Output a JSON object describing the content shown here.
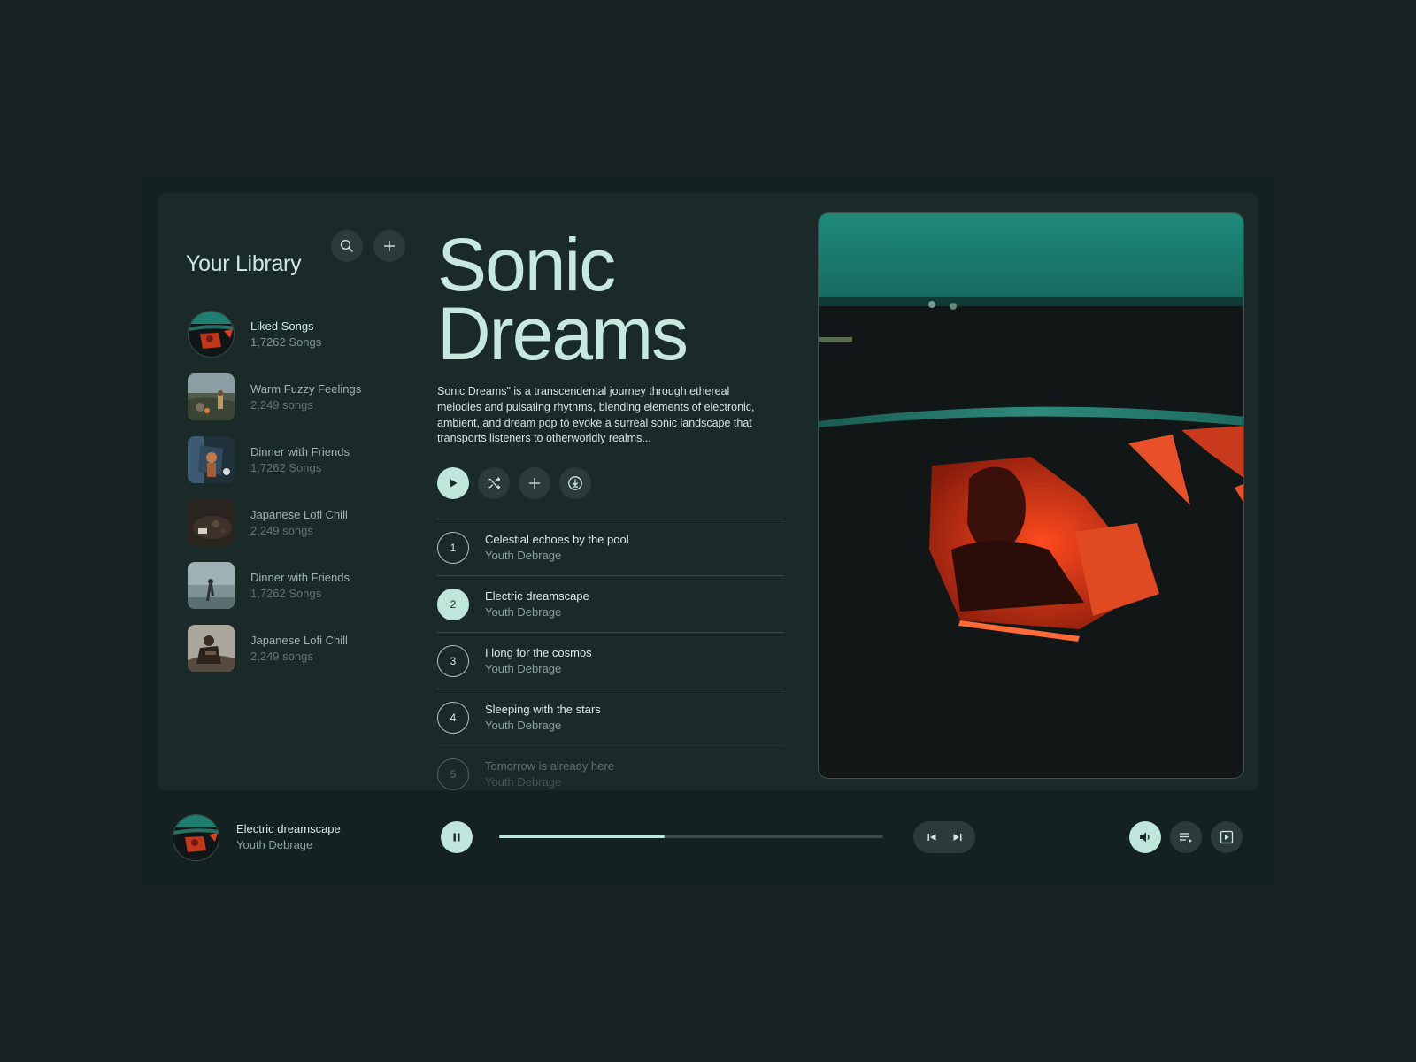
{
  "library": {
    "title": "Your Library",
    "items": [
      {
        "name": "Liked Songs",
        "count": "1,7262 Songs"
      },
      {
        "name": "Warm Fuzzy Feelings",
        "count": "2,249 songs"
      },
      {
        "name": "Dinner with Friends",
        "count": "1,7262 Songs"
      },
      {
        "name": "Japanese Lofi Chill",
        "count": "2,249 songs"
      },
      {
        "name": "Dinner with Friends",
        "count": "1,7262 Songs"
      },
      {
        "name": "Japanese Lofi Chill",
        "count": "2,249 songs"
      }
    ]
  },
  "playlist": {
    "title_line1": "Sonic",
    "title_line2": "Dreams",
    "description": "Sonic Dreams\" is a transcendental journey through ethereal melodies and pulsating rhythms, blending elements of electronic, ambient, and dream pop to evoke a surreal sonic landscape that transports listeners to otherworldly realms...",
    "tracks": [
      {
        "num": "1",
        "title": "Celestial echoes by the pool",
        "artist": "Youth Debrage"
      },
      {
        "num": "2",
        "title": "Electric dreamscape",
        "artist": "Youth Debrage"
      },
      {
        "num": "3",
        "title": "I long for the cosmos",
        "artist": "Youth Debrage"
      },
      {
        "num": "4",
        "title": "Sleeping with the stars",
        "artist": "Youth Debrage"
      },
      {
        "num": "5",
        "title": "Tomorrow is already here",
        "artist": "Youth Debrage"
      }
    ],
    "active_track": 2
  },
  "player": {
    "title": "Electric dreamscape",
    "artist": "Youth Debrage",
    "progress": 0.43
  },
  "colors": {
    "background": "#172423",
    "panel": "#1a2a29",
    "accent": "#bfe6da",
    "button": "#2c3b3a"
  },
  "icons": [
    "search-icon",
    "plus-icon",
    "play-icon",
    "shuffle-icon",
    "download-icon",
    "pause-icon",
    "skip-previous-icon",
    "skip-next-icon",
    "volume-icon",
    "queue-icon",
    "miniplayer-icon"
  ]
}
